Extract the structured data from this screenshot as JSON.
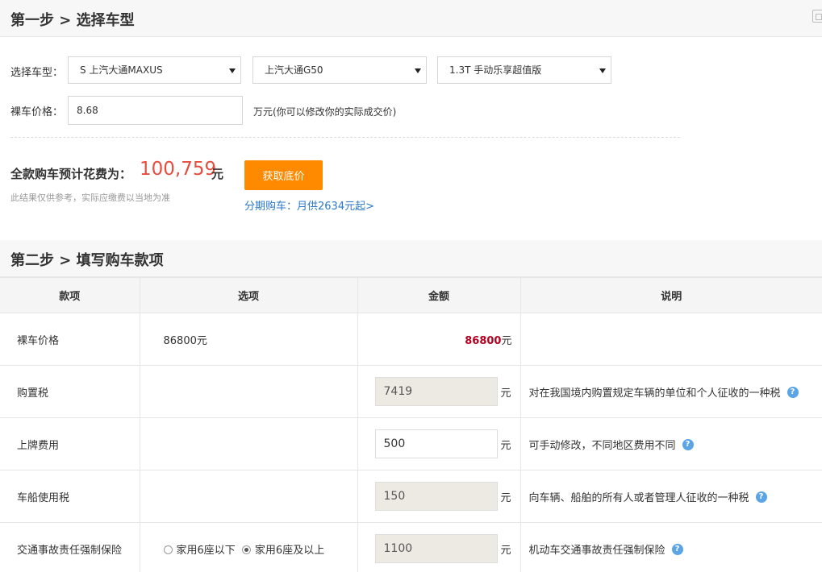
{
  "step1": {
    "title": "第一步 > 选择车型",
    "model_label": "选择车型：",
    "brand_select": "S 上汽大通MAXUS",
    "series_select": "上汽大通G50",
    "trim_select": "1.3T 手动乐享超值版",
    "price_label": "裸车价格：",
    "price_value": "8.68",
    "price_hint": "万元(你可以修改你的实际成交价)",
    "total_label": "全款购车预计花费为：",
    "total_amount": "100,759",
    "total_unit": "元",
    "note": "此结果仅供参考，实际应缴费以当地为准",
    "get_price_button": "获取底价",
    "installment_link": "分期购车：月供2634元起>"
  },
  "step2": {
    "title": "第二步 > 填写购车款项",
    "columns": [
      "款项",
      "选项",
      "金额",
      "说明"
    ],
    "unit": "元",
    "rows": [
      {
        "item": "裸车价格",
        "option": "86800元",
        "amount": "86800",
        "desc": ""
      },
      {
        "item": "购置税",
        "option": "",
        "amount": "7419",
        "desc": "对在我国境内购置规定车辆的单位和个人征收的一种税"
      },
      {
        "item": "上牌费用",
        "option": "",
        "amount": "500",
        "desc": "可手动修改，不同地区费用不同"
      },
      {
        "item": "车船使用税",
        "option": "",
        "amount": "150",
        "desc": "向车辆、船舶的所有人或者管理人征收的一种税"
      },
      {
        "item": "交通事故责任强制保险",
        "option_a": "家用6座以下",
        "option_b": "家用6座及以上",
        "amount": "1100",
        "desc": "机动车交通事故责任强制保险"
      }
    ]
  },
  "help_glyph": "?",
  "colors": {
    "accent_orange": "#ff8a00",
    "total_red": "#e84c3d",
    "amount_red": "#b5001f",
    "link_blue": "#2a78c9"
  }
}
